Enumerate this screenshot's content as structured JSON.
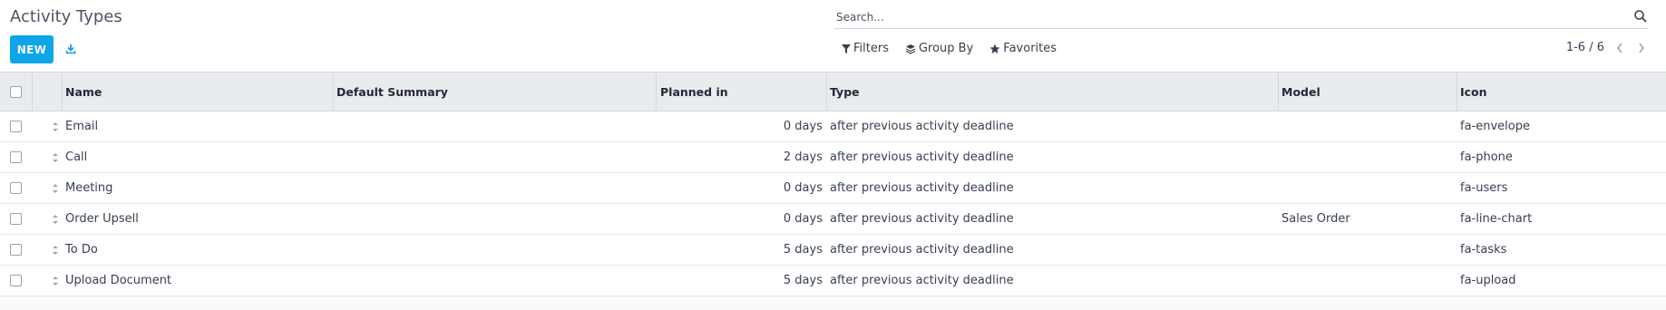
{
  "page": {
    "title": "Activity Types",
    "new_label": "NEW"
  },
  "search": {
    "placeholder": "Search..."
  },
  "filters": {
    "filters_label": "Filters",
    "group_by_label": "Group By",
    "favorites_label": "Favorites"
  },
  "pager": {
    "text": "1-6 / 6"
  },
  "table": {
    "headers": {
      "name": "Name",
      "summary": "Default Summary",
      "planned": "Planned in",
      "type": "Type",
      "model": "Model",
      "icon": "Icon"
    },
    "rows": [
      {
        "name": "Email",
        "summary": "",
        "planned": "0 days",
        "type": "after previous activity deadline",
        "model": "",
        "icon": "fa-envelope"
      },
      {
        "name": "Call",
        "summary": "",
        "planned": "2 days",
        "type": "after previous activity deadline",
        "model": "",
        "icon": "fa-phone"
      },
      {
        "name": "Meeting",
        "summary": "",
        "planned": "0 days",
        "type": "after previous activity deadline",
        "model": "",
        "icon": "fa-users"
      },
      {
        "name": "Order Upsell",
        "summary": "",
        "planned": "0 days",
        "type": "after previous activity deadline",
        "model": "Sales Order",
        "icon": "fa-line-chart"
      },
      {
        "name": "To Do",
        "summary": "",
        "planned": "5 days",
        "type": "after previous activity deadline",
        "model": "",
        "icon": "fa-tasks"
      },
      {
        "name": "Upload Document",
        "summary": "",
        "planned": "5 days",
        "type": "after previous activity deadline",
        "model": "",
        "icon": "fa-upload"
      }
    ]
  },
  "icons": {
    "download": "download-icon",
    "search": "search-icon",
    "filter": "filter-icon",
    "group_by": "layers-icon",
    "favorites": "star-icon",
    "prev": "chevron-left-icon",
    "next": "chevron-right-icon",
    "drag": "drag-handle-icon"
  },
  "colors": {
    "primary": "#0ea5e9",
    "header_bg": "#e9ecef",
    "page_bg": "#f9fafb"
  }
}
